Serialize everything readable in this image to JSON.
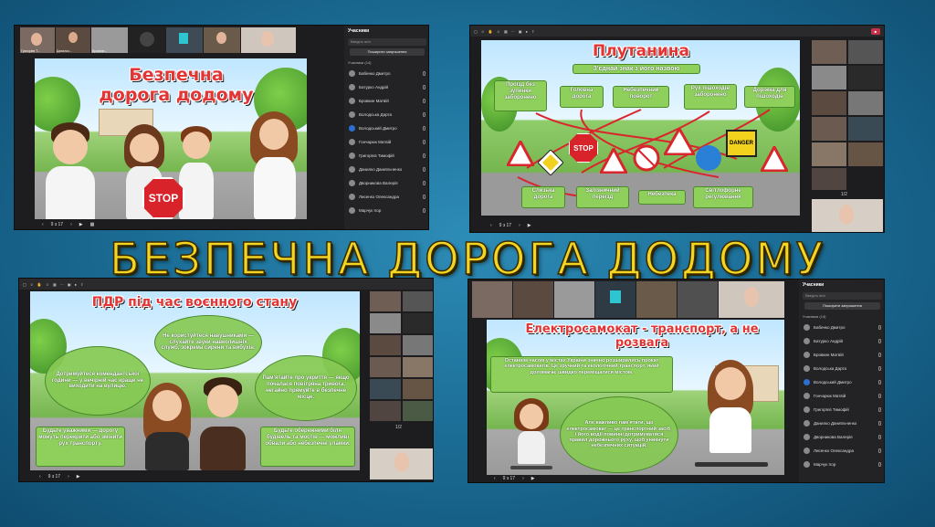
{
  "main_title": "БЕЗПЕЧНА ДОРОГА ДОДОМУ",
  "participants": {
    "header": "Учасники",
    "search_placeholder": "Введіть ім'я",
    "invite_label": "Поширити запрошення",
    "section_label": "Учасники (14)",
    "names": [
      "Бабенко Дмитро",
      "Батурко Андрій",
      "Бровкин Матвій",
      "Володська Дарта",
      "Володський Дмитро",
      "Гончарюк Матвій",
      "Григорїєв Тимофій",
      "Данилко Даниїльченко",
      "Дворникова Валерія",
      "Лисенко Олександра",
      "Марчук Ігор"
    ]
  },
  "panel1": {
    "title": "Безпечна дорога додому",
    "stop": "STOP",
    "thumb_names": [
      "Григорієв Т...",
      "Данилко...",
      "Бровкин...",
      "",
      ""
    ],
    "page": "9 з 17"
  },
  "panel2": {
    "title": "Плутанина",
    "subtitle": "З'єднай знак з його назвою",
    "top_labels": [
      "Проїзд без зупинки заборонено",
      "Головна дорога",
      "Небезпечний поворот",
      "Рух пішоходів заборонено",
      "Доріжка для пішоходів"
    ],
    "bottom_labels": [
      "Слизька дорога",
      "Залізничний переїзд",
      "Небезпека",
      "Світлофорне регулювання"
    ],
    "signs": [
      "STOP",
      "DANGER"
    ],
    "page": "9 з 17",
    "thumb_page": "1/2"
  },
  "panel3": {
    "title": "ПДР під час воєнного стану",
    "bubbles": [
      "Не користуйтеся навушниками — слухайте звуки навколишніх служб, зокрема сирени та вибухів.",
      "Дотримуйтеся комендантської години — у вечірній час краще не виходити на вулицю.",
      "Пам'ятайте про укриття — якщо почалася повітряна тривога, негайно прямуйте в безпечне місце.",
      "Будьте уважними — дорогу можуть перекрити або змінити рух транспорту.",
      "Будьте обережними біля будівель та мостів — можливі обвали або небезпечні уламки."
    ],
    "page": "9 з 17",
    "thumb_page": "1/2"
  },
  "panel4": {
    "title": "Електросамокат - транспорт, а не розвага",
    "box1": "Останнім часом у містах України значно розширились прокат електросамокатів. Це зручний та екологічний транспорт, який допомагає швидко переміщатися містом.",
    "box2": "Але важливо пам'ятати, що електросамокат — це транспортний засіб, і його водії повинні дотримуватися правил дорожнього руху, щоб уникнути небезпечних ситуацій.",
    "page": "9 з 17"
  },
  "colors": {
    "title_yellow": "#f3d624",
    "slide_red": "#e23636",
    "green_box": "#8fd05c",
    "teams_dark": "#1d1d1f"
  }
}
